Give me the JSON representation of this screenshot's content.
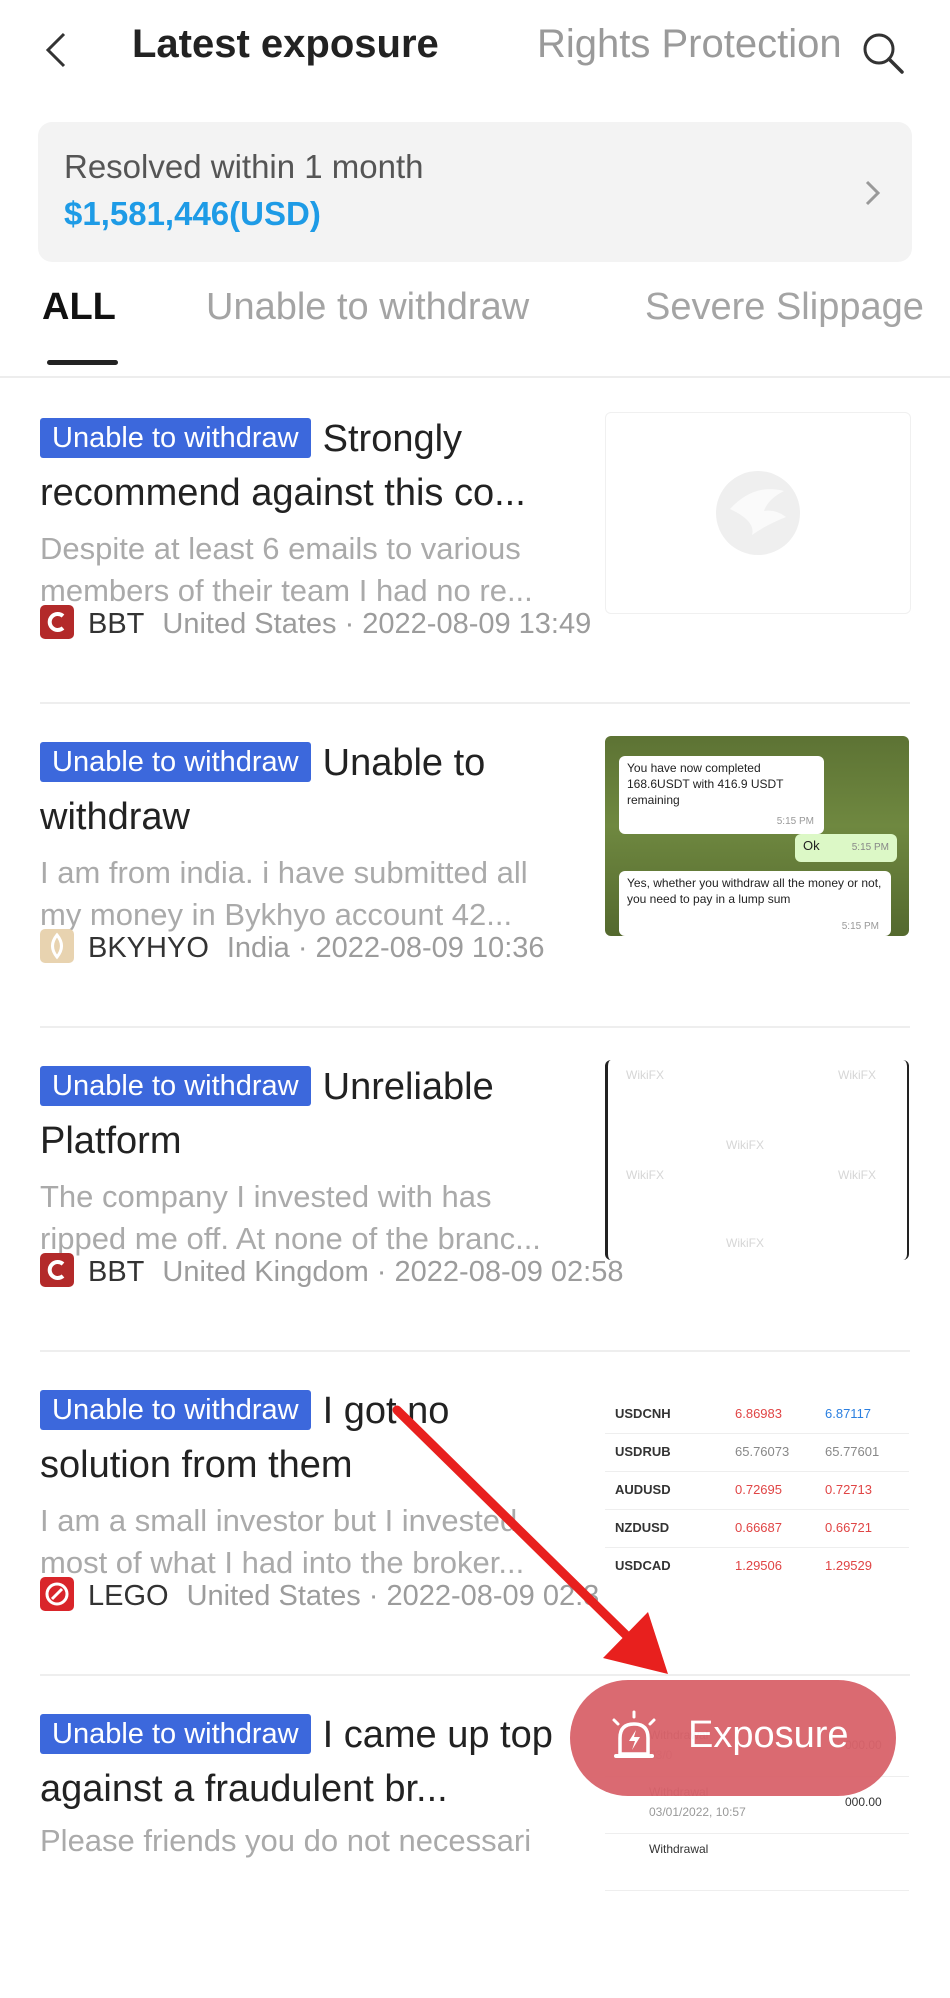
{
  "header": {
    "title": "Latest exposure",
    "secondary": "Rights Protection"
  },
  "summary": {
    "label": "Resolved within 1 month",
    "amount": "$1,581,446(USD)"
  },
  "tabs": [
    "ALL",
    "Unable to withdraw",
    "Severe Slippage"
  ],
  "items": [
    {
      "badge": "Unable to withdraw",
      "title": "Strongly recommend against this co...",
      "desc": "Despite at least 6 emails to various members of their team I had no re...",
      "broker": "BBT",
      "meta": "United States · 2022-08-09 13:49"
    },
    {
      "badge": "Unable to withdraw",
      "title": "Unable to withdraw",
      "desc": "I am from india. i have submitted all my money in Bykhyo account 42...",
      "broker": "BKYHYO",
      "meta": "India · 2022-08-09 10:36",
      "thumb": {
        "msg1": "You have now completed 168.6USDT with 416.9 USDT remaining",
        "time1": "5:15 PM",
        "msg2": "Ok",
        "time2": "5:15 PM",
        "msg3": "Yes, whether you withdraw all the money or not, you need to pay in a lump sum",
        "time3": "5:15 PM"
      }
    },
    {
      "badge": "Unable to withdraw",
      "title": "Unreliable Platform",
      "desc": "The company I invested with has ripped me off. At none of the branc...",
      "broker": "BBT",
      "meta": "United Kingdom · 2022-08-09 02:58",
      "thumb": {
        "watermark": "WikiFX"
      }
    },
    {
      "badge": "Unable to withdraw",
      "title": "I got no solution from them",
      "desc": "I am a small investor but I invested most of what I had into the broker...",
      "broker": "LEGO",
      "meta": "United States · 2022-08-09 02:3",
      "thumb": {
        "rows": [
          [
            "USDCNH",
            "6.86983",
            "6.87117"
          ],
          [
            "USDRUB",
            "65.76073",
            "65.77601"
          ],
          [
            "AUDUSD",
            "0.72695",
            "0.72713"
          ],
          [
            "NZDUSD",
            "0.66687",
            "0.66721"
          ],
          [
            "USDCAD",
            "1.29506",
            "1.29529"
          ]
        ]
      }
    },
    {
      "badge": "Unable to withdraw",
      "title": "I came up top against a fraudulent br...",
      "desc": "Please friends you do not necessari",
      "thumb": {
        "rows": [
          [
            "Withdrawal",
            "03/0",
            "000.00"
          ],
          [
            "Withdrawal",
            "03/01/2022, 10:57",
            "000.00"
          ],
          [
            "Withdrawal",
            "",
            ""
          ]
        ]
      }
    }
  ],
  "fab": {
    "label": "Exposure"
  },
  "colors": {
    "badge": "#3c68dc",
    "amount": "#1e9be6",
    "fab": "#d9646c",
    "arrow": "#e8201e"
  }
}
